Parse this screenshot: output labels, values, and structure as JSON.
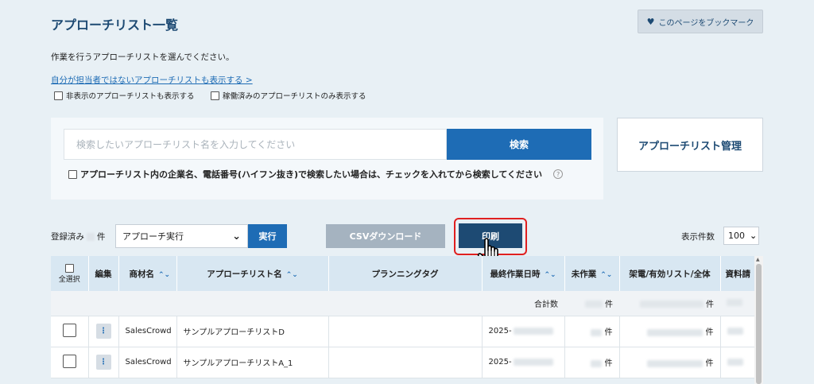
{
  "header": {
    "title": "アプローチリスト一覧",
    "bookmark_label": "このページをブックマーク",
    "description": "作業を行うアプローチリストを選んでください。",
    "show_others_link": "自分が担当者ではないアプローチリストも表示する >",
    "hidden_checkbox_label": "非表示のアプローチリストも表示する",
    "active_checkbox_label": "稼働済みのアプローチリストのみ表示する"
  },
  "search": {
    "placeholder": "検索したいアプローチリスト名を入力してください",
    "button_label": "検索",
    "company_checkbox_label": "アプローチリスト内の企業名、電話番号(ハイフン抜き)で検索したい場合は、チェックを入れてから検索してください",
    "help": "?"
  },
  "manage_button_label": "アプローチリスト管理",
  "toolbar": {
    "registered_prefix": "登録済み",
    "registered_suffix": "件",
    "action_select": "アプローチ実行",
    "exec_label": "実行",
    "csv_label": "CSVダウンロード",
    "print_label": "印刷",
    "page_size_label": "表示件数",
    "page_size_value": "100"
  },
  "table": {
    "headers": {
      "select_all": "全選択",
      "edit": "編集",
      "product": "商材名",
      "list_name": "アプローチリスト名",
      "planning_tag": "プランニングタグ",
      "last_work": "最終作業日時",
      "unworked": "未作業",
      "calls": "架電/有効リスト/全体",
      "materials": "資料請"
    },
    "summary": {
      "label": "合計数",
      "unit": "件"
    },
    "rows": [
      {
        "edit": "⋮",
        "product": "SalesCrowd",
        "list_name": "サンプルアプローチリストD",
        "last_work": "2025-",
        "unit": "件"
      },
      {
        "edit": "⋮",
        "product": "SalesCrowd",
        "list_name": "サンプルアプローチリストA_1",
        "last_work": "2025-",
        "unit": "件"
      }
    ]
  },
  "colors": {
    "primary": "#1e6cb5",
    "dark_navy": "#1d4a73",
    "highlight": "#e02020",
    "background": "#e8f0f5"
  }
}
